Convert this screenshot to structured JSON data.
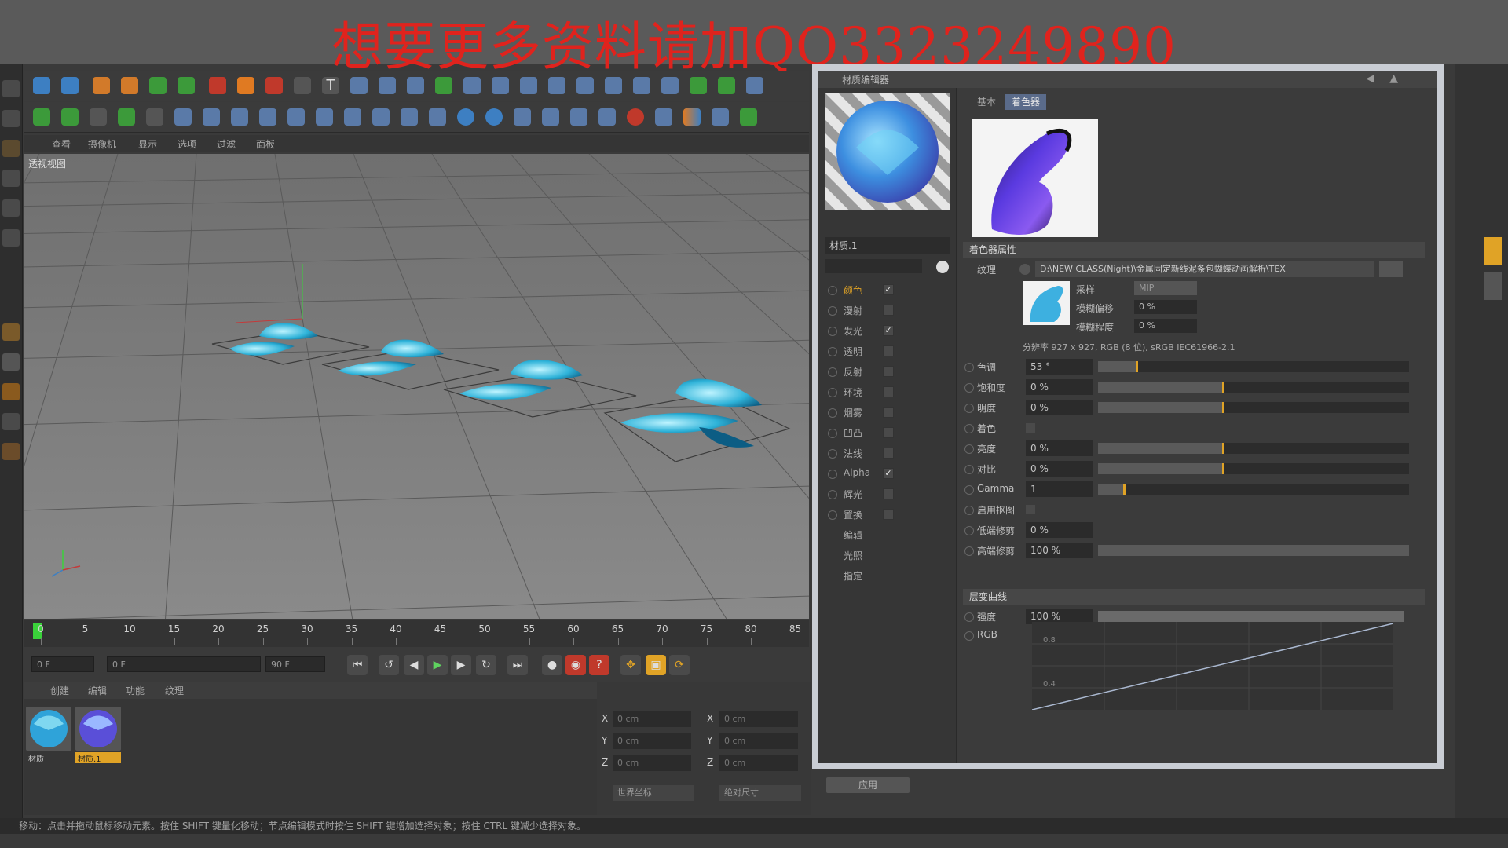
{
  "banner": {
    "text": "想要更多资料请加QQ3323249890"
  },
  "menu": {
    "items": [
      "查看",
      "摄像机",
      "显示",
      "选项",
      "过滤",
      "面板"
    ]
  },
  "viewport": {
    "label": "透视视图"
  },
  "timeline": {
    "ticks": [
      "0",
      "5",
      "10",
      "15",
      "20",
      "25",
      "30",
      "35",
      "40",
      "45",
      "50",
      "55",
      "60",
      "65",
      "70",
      "75",
      "80",
      "85"
    ],
    "current_frame": "0 F",
    "start_field": "0 F",
    "end_field": "90 F",
    "min_field": "90 F"
  },
  "material_manager": {
    "menu": [
      "创建",
      "编辑",
      "功能",
      "纹理"
    ],
    "materials": [
      {
        "name": "材质"
      },
      {
        "name": "材质.1"
      }
    ]
  },
  "coordinates": {
    "rows": [
      {
        "axis": "X",
        "pos": "0 cm",
        "axis2": "X",
        "size": "0 cm"
      },
      {
        "axis": "Y",
        "pos": "0 cm",
        "axis2": "Y",
        "size": "0 cm"
      },
      {
        "axis": "Z",
        "pos": "0 cm",
        "axis2": "Z",
        "size": "0 cm"
      }
    ],
    "dropdown1": "世界坐标",
    "dropdown2": "绝对尺寸",
    "apply": "应用"
  },
  "status_bar": {
    "text": "移动：点击并拖动鼠标移动元素。按住 SHIFT 键量化移动；节点编辑模式时按住 SHIFT 键增加选择对象；按住 CTRL 键减少选择对象。"
  },
  "material_editor": {
    "title": "材质编辑器",
    "material_name": "材质.1",
    "channels": [
      {
        "label": "颜色",
        "checked": "✓"
      },
      {
        "label": "漫射",
        "checked": ""
      },
      {
        "label": "发光",
        "checked": "✓"
      },
      {
        "label": "透明",
        "checked": ""
      },
      {
        "label": "反射",
        "checked": ""
      },
      {
        "label": "环境",
        "checked": ""
      },
      {
        "label": "烟雾",
        "checked": ""
      },
      {
        "label": "凹凸",
        "checked": ""
      },
      {
        "label": "法线",
        "checked": ""
      },
      {
        "label": "Alpha",
        "checked": "✓"
      },
      {
        "label": "辉光",
        "checked": ""
      },
      {
        "label": "置换",
        "checked": ""
      }
    ],
    "extra_items": [
      "编辑",
      "光照",
      "指定"
    ],
    "tabs": [
      "基本",
      "着色器"
    ],
    "section_shader": "着色器属性",
    "texture_label": "纹理",
    "texture_path": "D:\\NEW CLASS(Night)\\金属固定新线泥条包蝴蝶动画解析\\TEX",
    "sampling_label": "采样",
    "sampling_value": "MIP",
    "blur_offset_label": "模糊偏移",
    "blur_offset_value": "0 %",
    "blur_scale_label": "模糊程度",
    "blur_scale_value": "0 %",
    "resolution": "分辨率 927 x 927, RGB (8 位), sRGB IEC61966-2.1",
    "props": [
      {
        "label": "色调",
        "value": "53 °",
        "level": 0.12
      },
      {
        "label": "饱和度",
        "value": "0 %",
        "level": 0.4
      },
      {
        "label": "明度",
        "value": "0 %",
        "level": 0.4
      },
      {
        "label": "着色",
        "value": "",
        "level": null
      },
      {
        "label": "亮度",
        "value": "0 %",
        "level": 0.4
      },
      {
        "label": "对比",
        "value": "0 %",
        "level": 0.4
      },
      {
        "label": "Gamma",
        "value": "1",
        "level": 0.08
      },
      {
        "label": "启用抠图",
        "value": "",
        "level": null
      },
      {
        "label": "低端修剪",
        "value": "0 %",
        "level": null
      },
      {
        "label": "高端修剪",
        "value": "100 %",
        "level": 1.0
      }
    ],
    "section_curves": "层变曲线",
    "strength_label": "强度",
    "strength_value": "100 %",
    "rgb_label": "RGB",
    "curve_labels": [
      "0.8",
      "0.4"
    ]
  },
  "colors": {
    "accent": "#e0a326",
    "banner_text": "#e0231d"
  }
}
